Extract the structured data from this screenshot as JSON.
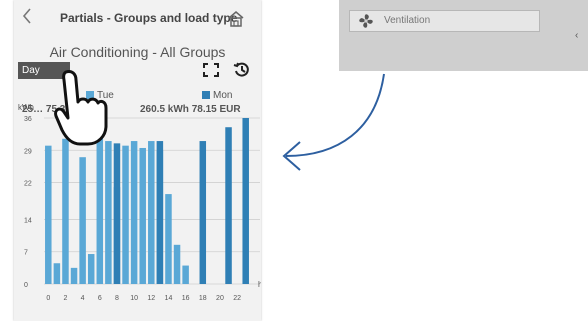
{
  "header": {
    "title": "Partials - Groups and load type",
    "back_icon": "chevron-left-icon",
    "home_icon": "home-icon"
  },
  "subtitle": "Air Conditioning - All Groups",
  "controls": {
    "day_label": "Day"
  },
  "legend": {
    "tue": {
      "label": "Tue",
      "value": "25… 75.39 EUR",
      "color": "#5aa8d6"
    },
    "mon": {
      "label": "Mon",
      "value": "260.5 kWh 78.15 EUR",
      "color": "#2f7fb5"
    }
  },
  "panel": {
    "button_label": "Ventilation",
    "edge_char": "‹"
  },
  "chart_data": {
    "type": "bar",
    "ylabel": "kWh",
    "xlabel": "h",
    "ylim": [
      0,
      36
    ],
    "y_ticks": [
      0,
      7,
      14,
      22,
      29,
      36
    ],
    "x_ticks": [
      0,
      2,
      4,
      6,
      8,
      10,
      12,
      14,
      16,
      18,
      20,
      22
    ],
    "categories": [
      0,
      1,
      2,
      3,
      4,
      5,
      6,
      7,
      8,
      9,
      10,
      11,
      12,
      13,
      14,
      15,
      16,
      17,
      18,
      19,
      20,
      21,
      22,
      23
    ],
    "series": [
      {
        "name": "Tue",
        "color": "#5aa8d6",
        "values": [
          30,
          4.5,
          31.5,
          3.5,
          27.5,
          6.5,
          33,
          31,
          21,
          30,
          31,
          29.5,
          31,
          29,
          19.5,
          8.5,
          4,
          0,
          0,
          0,
          0,
          0,
          0,
          0
        ]
      },
      {
        "name": "Mon",
        "color": "#2f7fb5",
        "values": [
          0,
          0,
          0,
          0,
          0,
          0,
          0,
          0,
          30.5,
          0,
          0,
          0,
          0,
          31,
          0,
          0,
          0,
          0,
          31,
          0,
          0,
          34,
          0,
          36
        ]
      }
    ]
  }
}
